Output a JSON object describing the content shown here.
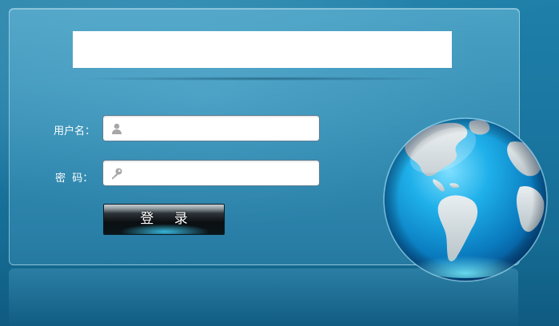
{
  "login_form": {
    "title_box_text": "",
    "username_label": "用户名：",
    "password_label": "密  码：",
    "username_value": "",
    "password_value": "",
    "login_button_label": "登 录"
  },
  "icons": {
    "username": "user-icon",
    "password": "key-icon",
    "globe": "globe-icon"
  },
  "colors": {
    "background": "#1a76a0",
    "panel": "#5aa8cc",
    "button": "#0b0f12",
    "button_glow": "#3cc8f0",
    "globe_ocean": "#1aa7e0",
    "globe_land": "#cfd8dc"
  }
}
